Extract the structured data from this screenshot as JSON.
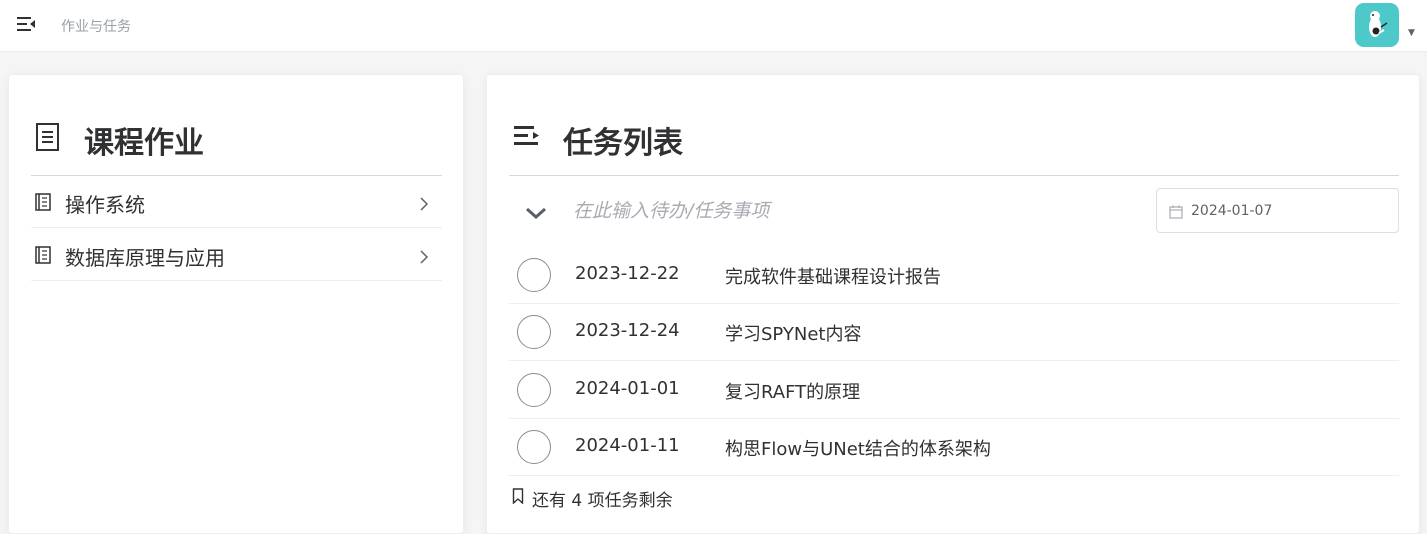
{
  "header": {
    "breadcrumb": "作业与任务",
    "avatar_color": "#4ec9c9"
  },
  "courses": {
    "title": "课程作业",
    "items": [
      {
        "label": "操作系统"
      },
      {
        "label": "数据库原理与应用"
      }
    ]
  },
  "tasks": {
    "title": "任务列表",
    "input_placeholder": "在此输入待办/任务事项",
    "date_value": "2024-01-07",
    "items": [
      {
        "date": "2023-12-22",
        "text": "完成软件基础课程设计报告"
      },
      {
        "date": "2023-12-24",
        "text": "学习SPYNet内容"
      },
      {
        "date": "2024-01-01",
        "text": "复习RAFT的原理"
      },
      {
        "date": "2024-01-11",
        "text": "构思Flow与UNet结合的体系架构"
      }
    ],
    "remaining_text": "还有 4 项任务剩余"
  }
}
